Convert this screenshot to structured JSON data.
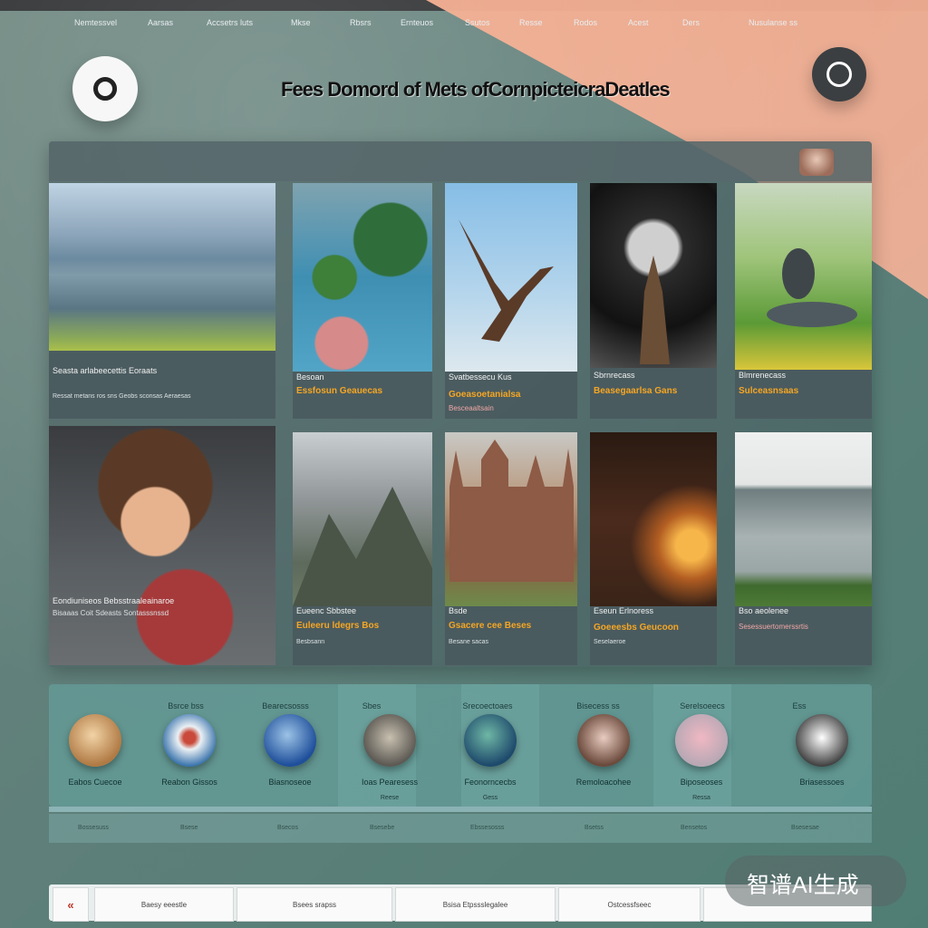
{
  "page": {
    "title": "Fees Domord of Mets ofCornpicteicraDeatles"
  },
  "nav": {
    "items": [
      "Nemtessvel",
      "Aarsas",
      "Accsetrs luts",
      "Mkse",
      "Rbsrs",
      "Ernteuos",
      "Ssutos",
      "Resse",
      "Rodos",
      "Acest",
      "Ders",
      "Nusulanse ss"
    ]
  },
  "cards": [
    {
      "title": "Seasta arlabeecettis Eoraats",
      "orange": "",
      "small": "Ressat metans ros sns Geobs sconsas Aeraesas",
      "pink": ""
    },
    {
      "title": "Besoan",
      "orange": "Essfosun Geauecas",
      "small": "",
      "pink": ""
    },
    {
      "title": "Svatbessecu Kus",
      "orange": "Goeasoetanialsa",
      "small": "",
      "pink": "Besceaaltsain"
    },
    {
      "title": "Sbrnrecass",
      "orange": "Beasegaarlsa Gans",
      "small": "",
      "pink": ""
    },
    {
      "title": "Blmrenecass",
      "orange": "Sulceasnsaas",
      "small": "",
      "pink": ""
    },
    {
      "title": "Eondiuniseos Bebsstraaleainaroe",
      "orange": "",
      "small": "Bisaaas Coit Sdeasts Sontasssnssd",
      "pink": ""
    },
    {
      "title": "Eueenc Sbbstee",
      "orange": "Euleeru ldegrs Bos",
      "small": "Besbsann",
      "pink": ""
    },
    {
      "title": "Bsde",
      "orange": "Gsacere cee Beses",
      "small": "Besane sacas",
      "pink": ""
    },
    {
      "title": "Eseun Erlnoress",
      "orange": "Goeeesbs Geucoon",
      "small": "Seselaeroe",
      "pink": ""
    },
    {
      "title": "Bso aeolenee",
      "orange": "",
      "small": "",
      "pink": "Sesessuertomerssrtis"
    }
  ],
  "categories": [
    {
      "top": "",
      "label": "Eabos Cuecoe",
      "sub": ""
    },
    {
      "top": "Bsrce bss",
      "label": "Reabon Gissos",
      "sub": ""
    },
    {
      "top": "Bearecsosss",
      "label": "Biasnoseoe",
      "sub": ""
    },
    {
      "top": "Sbes",
      "label": "Ioas Pearesess",
      "sub": "Reese"
    },
    {
      "top": "Srecoectoaes",
      "label": "Feonorncecbs",
      "sub": "Gess"
    },
    {
      "top": "Bisecess ss",
      "label": "Remoloacohee",
      "sub": ""
    },
    {
      "top": "Serelsoeecs",
      "label": "Biposeoses",
      "sub": "Ressa"
    },
    {
      "top": "Ess",
      "label": "Briasessoes",
      "sub": ""
    }
  ],
  "strip": [
    "Bossesuss",
    "Bsese",
    "Bsecos",
    "Bsesebe",
    "Ebssesosss",
    "Bsetss",
    "Bensetos",
    "Bsesesae"
  ],
  "pager": {
    "prev": "«",
    "items": [
      "Baesy eeestle",
      "Bsees srapss",
      "Bsisa Etpssslegalee",
      "Ostcessfseec",
      ""
    ]
  },
  "watermark": "智谱AI生成"
}
